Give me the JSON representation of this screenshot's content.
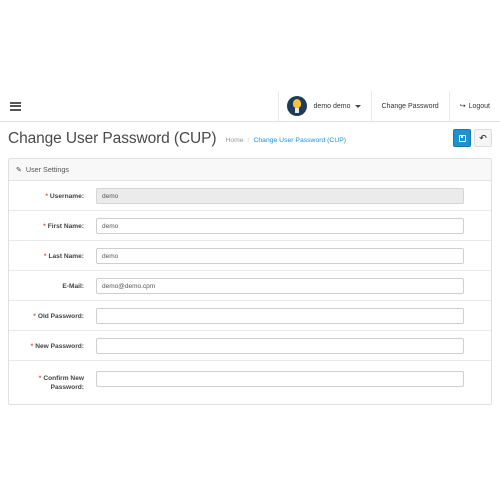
{
  "header": {
    "user_name": "demo demo",
    "change_password_label": "Change Password",
    "logout_label": "Logout"
  },
  "page": {
    "title": "Change User Password (CUP)",
    "breadcrumb": {
      "home": "Home",
      "current": "Change User Password (CUP)"
    }
  },
  "panel": {
    "heading": "User Settings"
  },
  "form": {
    "username": {
      "label": "Username:",
      "value": "demo",
      "required": "*"
    },
    "first_name": {
      "label": "First Name:",
      "value": "demo",
      "required": "*"
    },
    "last_name": {
      "label": "Last Name:",
      "value": "demo",
      "required": "*"
    },
    "email": {
      "label": "E-Mail:",
      "value": "demo@demo.cpm"
    },
    "old_password": {
      "label": "Old Password:",
      "value": "",
      "required": "*"
    },
    "new_password": {
      "label": "New Password:",
      "value": "",
      "required": "*"
    },
    "confirm_password": {
      "label_line1": "Confirm New",
      "label_line2": "Password:",
      "value": "",
      "required": "*"
    }
  },
  "colors": {
    "accent": "#1e91cf",
    "required": "#e3503e"
  },
  "icons": {
    "menu": "hamburger-icon",
    "save": "save-icon",
    "back": "reply-icon",
    "panel": "pencil-icon",
    "logout": "sign-out-icon"
  }
}
